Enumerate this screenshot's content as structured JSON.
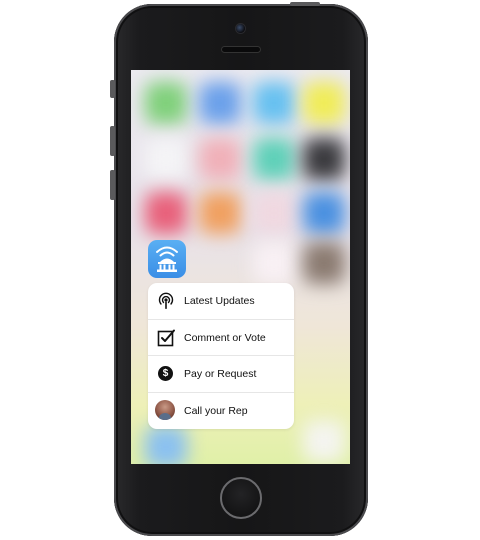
{
  "app": {
    "icon_name": "wifi-capitol-icon",
    "icon_color": "#3a8ee6"
  },
  "quick_actions": [
    {
      "label": "Latest Updates",
      "icon": "podcast-icon"
    },
    {
      "label": "Comment or Vote",
      "icon": "checkbox-icon"
    },
    {
      "label": "Pay or Request",
      "icon": "dollar-icon",
      "glyph": "$"
    },
    {
      "label": "Call your Rep",
      "icon": "avatar"
    }
  ],
  "colors": {
    "menu_background": "#ffffff",
    "text": "#111111",
    "phone_body": "#1b1b1d"
  }
}
